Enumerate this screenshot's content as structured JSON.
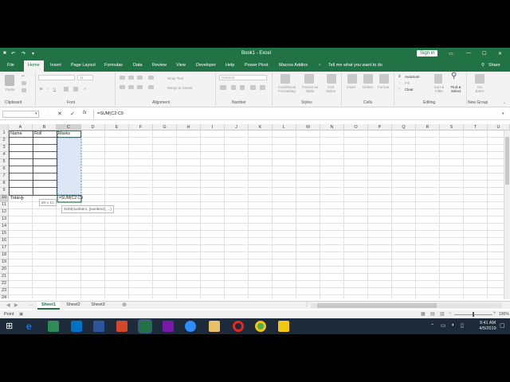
{
  "title_bar": {
    "title": "Book1 - Excel",
    "sign_in": "Sign in"
  },
  "menu_tabs": [
    "File",
    "Home",
    "Insert",
    "Page Layout",
    "Formulas",
    "Data",
    "Review",
    "View",
    "Developer",
    "Help",
    "Power Pivot",
    "Macros Addins"
  ],
  "tell_me": "Tell me what you want to do",
  "share": "Share",
  "ribbon": {
    "groups": [
      "Clipboard",
      "Font",
      "Alignment",
      "Number",
      "Styles",
      "Cells",
      "Editing",
      "New Group"
    ],
    "font_size": "11",
    "number_format": "General",
    "wrap_text": "Wrap Text",
    "merge_center": "Merge & Center",
    "autosum": "AutoSum",
    "fill": "Fill",
    "clear": "Clear",
    "sort_filter": "Sort & Filter",
    "find_select": "Find & Select",
    "conditional": "Conditional Formatting",
    "format_table": "Format as Table",
    "cell_styles": "Cell Styles",
    "insert": "Insert",
    "delete": "Delete",
    "format": "Format",
    "paste": "Paste",
    "on_enter": "On Enter"
  },
  "formula_bar": {
    "name_box": "",
    "formula": "=SUM(C2:C9"
  },
  "columns": [
    "A",
    "B",
    "C",
    "D",
    "E",
    "F",
    "G",
    "H",
    "I",
    "J",
    "K",
    "L",
    "M",
    "N",
    "O",
    "P",
    "Q",
    "R",
    "S",
    "T",
    "U"
  ],
  "rows": [
    "1",
    "2",
    "3",
    "4",
    "5",
    "6",
    "7",
    "8",
    "9",
    "10",
    "11",
    "12",
    "13",
    "14",
    "15",
    "16",
    "17",
    "18",
    "19",
    "20",
    "21",
    "22",
    "23",
    "24"
  ],
  "cells": {
    "A1": "Name",
    "B1": "Roll",
    "C1": "Marks",
    "A10": "Total",
    "C10": "=SUM(C2:C9"
  },
  "tooltip_size": "8R x 1C",
  "func_tip": "SUM(number1, [number2], ...)",
  "sheet_tabs": [
    "Sheet1",
    "Sheet2",
    "Sheet3"
  ],
  "status": "Point",
  "zoom": "100%",
  "clock": {
    "time": "9:41 AM",
    "date": "4/5/2019"
  }
}
